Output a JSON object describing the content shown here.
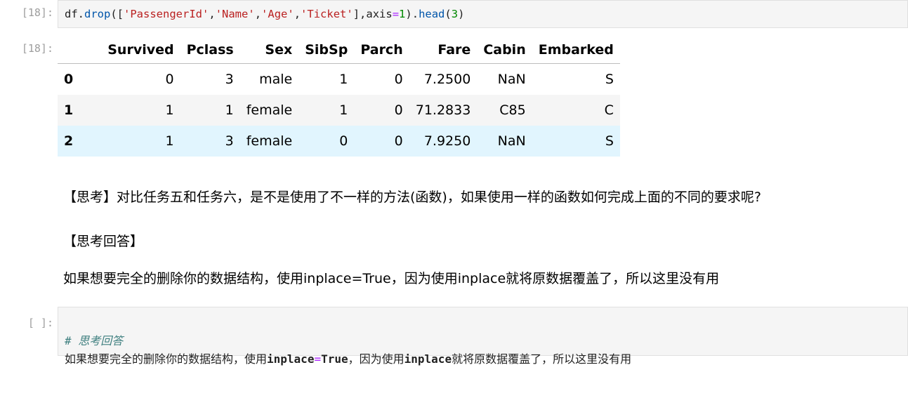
{
  "cell1": {
    "prompt": "[18]:",
    "code": {
      "t1": "df",
      "t2": ".",
      "t3": "drop",
      "t4": "([",
      "t5": "'PassengerId'",
      "t6": ",",
      "t7": "'Name'",
      "t8": ",",
      "t9": "'Age'",
      "t10": ",",
      "t11": "'Ticket'",
      "t12": "],",
      "t13": "axis",
      "t14": "=",
      "t15": "1",
      "t16": ").",
      "t17": "head",
      "t18": "(",
      "t19": "3",
      "t20": ")"
    }
  },
  "output1": {
    "prompt": "[18]:",
    "table": {
      "columns": [
        "Survived",
        "Pclass",
        "Sex",
        "SibSp",
        "Parch",
        "Fare",
        "Cabin",
        "Embarked"
      ],
      "rows": [
        {
          "index": "0",
          "cells": [
            "0",
            "3",
            "male",
            "1",
            "0",
            "7.2500",
            "NaN",
            "S"
          ]
        },
        {
          "index": "1",
          "cells": [
            "1",
            "1",
            "female",
            "1",
            "0",
            "71.2833",
            "C85",
            "C"
          ]
        },
        {
          "index": "2",
          "cells": [
            "1",
            "3",
            "female",
            "0",
            "0",
            "7.9250",
            "NaN",
            "S"
          ]
        }
      ]
    }
  },
  "markdown": {
    "question": "【思考】对比任务五和任务六，是不是使用了不一样的方法(函数)，如果使用一样的函数如何完成上面的不同的要求呢?",
    "answer_heading": "【思考回答】",
    "answer": "如果想要完全的删除你的数据结构，使用inplace=True，因为使用inplace就将原数据覆盖了，所以这里没有用"
  },
  "cell2": {
    "prompt": "[ ]:",
    "comment": "# 思考回答",
    "line2_a": "如果想要完全的删除你的数据结构，使用",
    "line2_b": "inplace",
    "line2_c": "=",
    "line2_d": "True",
    "line2_e": "，因为使用",
    "line2_f": "inplace",
    "line2_g": "就将原数据覆盖了，所以这里没有用"
  }
}
